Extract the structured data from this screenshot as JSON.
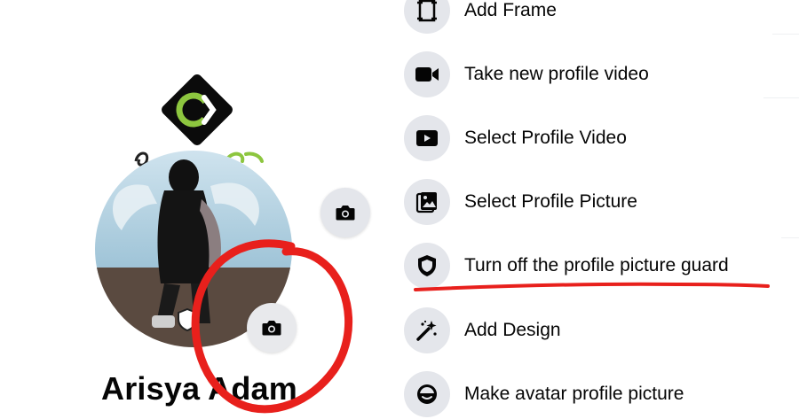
{
  "profile": {
    "name": "Arisya Adam"
  },
  "menu": {
    "items": [
      {
        "label": "Add Frame",
        "icon": "frame-icon"
      },
      {
        "label": "Take new profile video",
        "icon": "video-camera-icon"
      },
      {
        "label": "Select Profile Video",
        "icon": "play-icon"
      },
      {
        "label": "Select Profile Picture",
        "icon": "photos-icon"
      },
      {
        "label": "Turn off the profile picture guard",
        "icon": "shield-icon"
      },
      {
        "label": "Add Design",
        "icon": "magic-wand-icon"
      },
      {
        "label": "Make avatar profile picture",
        "icon": "avatar-face-icon"
      }
    ]
  },
  "colors": {
    "icon_bg": "#e4e6eb",
    "annotation_red": "#e8201c",
    "logo_green": "#8dc63f"
  }
}
